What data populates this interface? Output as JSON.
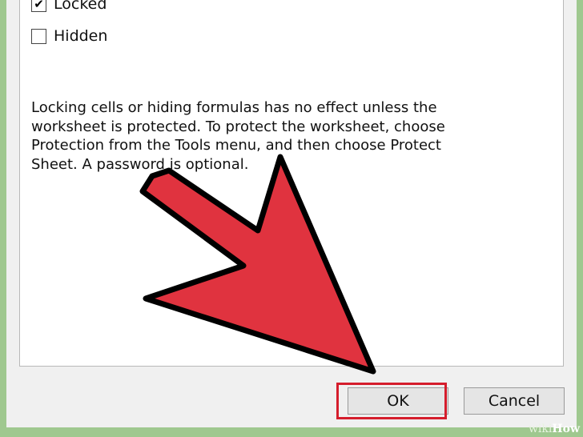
{
  "options": {
    "locked": {
      "label": "Locked",
      "checked": true
    },
    "hidden": {
      "label": "Hidden",
      "checked": false
    }
  },
  "info_text": "Locking cells or hiding formulas has no effect unless the worksheet is protected. To protect the worksheet, choose Protection from the Tools menu, and then choose Protect Sheet. A password is optional.",
  "buttons": {
    "ok": "OK",
    "cancel": "Cancel"
  },
  "watermark": {
    "wiki": "wiki",
    "how": "How"
  },
  "colors": {
    "arrow_fill": "#e0333f",
    "highlight": "#d51d2c",
    "background": "#9fc88f"
  },
  "icons": {
    "check": "checkmark-icon",
    "arrow": "pointer-arrow-icon"
  }
}
